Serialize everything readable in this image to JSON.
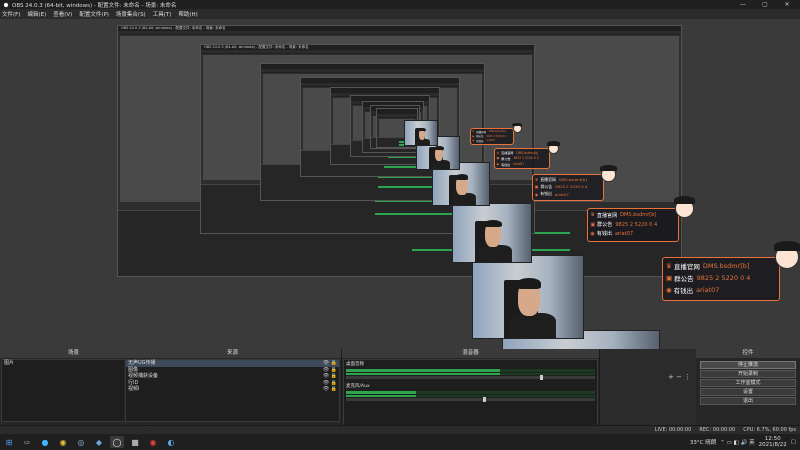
{
  "window": {
    "title": "OBS 24.0.3 (64-bit, windows) - 配置文件: 未命名 - 场景: 未命名",
    "controls": [
      "—",
      "▢",
      "✕"
    ]
  },
  "menu": [
    "文件(F)",
    "编辑(E)",
    "查看(V)",
    "配置文件(P)",
    "场景集合(S)",
    "工具(T)",
    "帮助(H)"
  ],
  "scenes": {
    "title": "场景",
    "items": [
      {
        "label": "图片"
      }
    ]
  },
  "sources": {
    "title": "来源",
    "items": [
      {
        "label": "无声UG传播"
      },
      {
        "label": "图像"
      },
      {
        "label": "视频捕获设备"
      },
      {
        "label": "行ID"
      },
      {
        "label": "视频I"
      }
    ]
  },
  "mixer": {
    "title": "混音器",
    "channels": [
      {
        "label": "桌面音频",
        "level": 0.62,
        "volume": 0.78
      },
      {
        "label": "麦克风/Aux",
        "level": 0.28,
        "volume": 0.55
      }
    ]
  },
  "controls": {
    "title": "控件",
    "buttons": [
      {
        "label": "停止推流"
      },
      {
        "label": "开始录制"
      },
      {
        "label": "工作室模式"
      },
      {
        "label": "设置"
      },
      {
        "label": "退出"
      }
    ]
  },
  "status": {
    "live": "LIVE: 00:00:00",
    "rec": "REC: 00:00:00",
    "cpu": "CPU: 6.7%, 60.00 fps"
  },
  "overlay": {
    "items": [
      {
        "label": "直播官网",
        "value": "DMS.bsdmr[b]"
      },
      {
        "label": "群公告",
        "value": "9825 2 5220 0 4"
      },
      {
        "label": "有钱出",
        "value": "ariat07"
      }
    ]
  },
  "taskbar": {
    "weather": "33°C 晴朗",
    "time": "12:50",
    "date": "2021/8/22"
  },
  "colors": {
    "accent": "#e8743b",
    "meter": "#2da44e"
  }
}
